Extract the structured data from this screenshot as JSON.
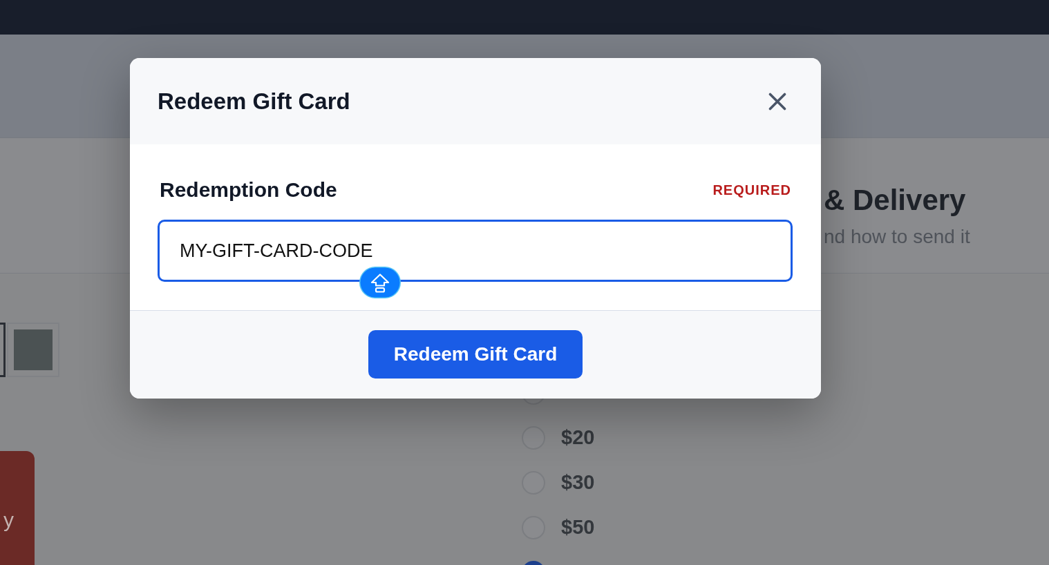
{
  "background_page": {
    "section": {
      "heading": "& Delivery",
      "subtitle": "nd how to send it"
    },
    "swatches": [
      {
        "selected": true
      },
      {
        "color": "#4b5253",
        "selected": false
      }
    ],
    "action_button": {
      "label": "y"
    },
    "amount_options": [
      {
        "selected": false
      },
      {
        "label": "$20",
        "selected": false
      },
      {
        "label": "$30",
        "selected": false
      },
      {
        "label": "$50",
        "selected": false
      },
      {
        "selected": true
      }
    ]
  },
  "dialog": {
    "title": "Redeem Gift Card",
    "field": {
      "label": "Redemption Code",
      "required_note": "REQUIRED",
      "value": "MY-GIFT-CARD-CODE",
      "focused": true,
      "caps_lock": true
    },
    "submit_button": {
      "label": "Redeem Gift Card"
    }
  }
}
